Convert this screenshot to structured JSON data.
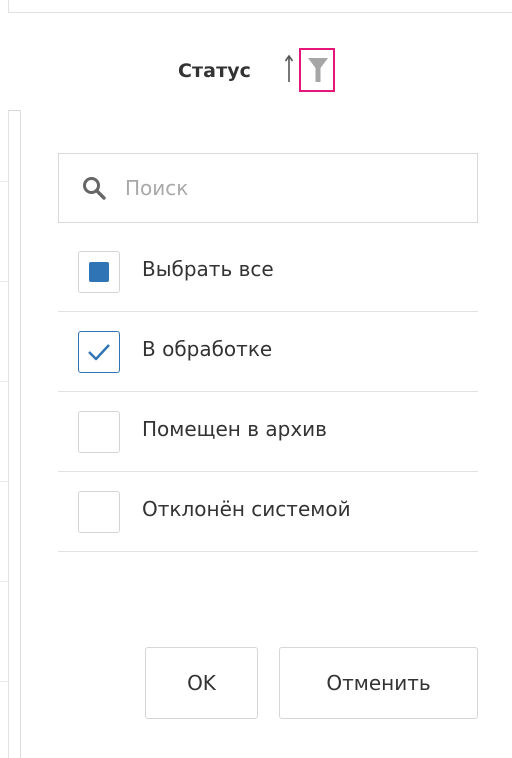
{
  "header": {
    "title": "Статус",
    "icons": {
      "sort": "sort-up-arrow-icon",
      "filter": "funnel-filter-icon"
    },
    "filter_highlight_color": "#e5177a"
  },
  "filter_popup": {
    "search": {
      "placeholder": "Поиск",
      "value": "",
      "icon": "search-icon"
    },
    "options": [
      {
        "label": "Выбрать все",
        "state": "indeterminate"
      },
      {
        "label": "В обработке",
        "state": "checked"
      },
      {
        "label": "Помещен в архив",
        "state": "unchecked"
      },
      {
        "label": "Отклонён системой",
        "state": "unchecked"
      }
    ],
    "buttons": {
      "ok": "OK",
      "cancel": "Отменить"
    },
    "accent_color": "#2f74b5"
  }
}
